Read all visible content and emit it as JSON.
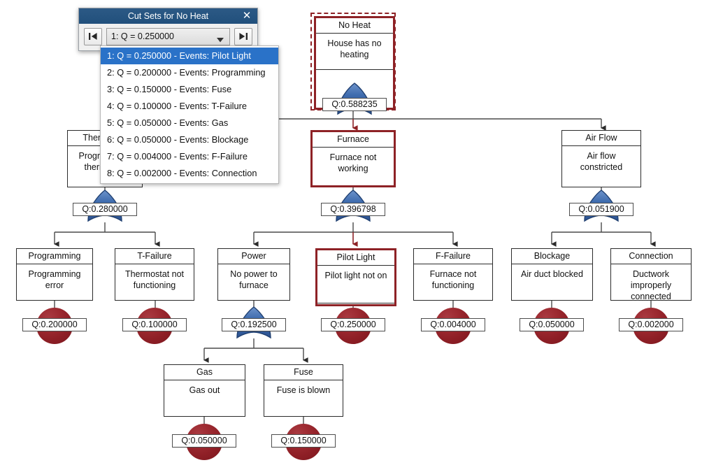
{
  "dialog": {
    "title": "Cut Sets for No Heat",
    "close_label": "✕",
    "prev_button_label": "first",
    "next_button_label": "last",
    "combo_value": "1: Q = 0.250000",
    "combo_caret": "▼",
    "options": [
      "1: Q = 0.250000 - Events: Pilot Light",
      "2: Q = 0.200000 - Events: Programming",
      "3: Q = 0.150000 - Events: Fuse",
      "4: Q = 0.100000 - Events: T-Failure",
      "5: Q = 0.050000 - Events: Gas",
      "6: Q = 0.050000 - Events: Blockage",
      "7: Q = 0.004000 - Events: F-Failure",
      "8: Q = 0.002000 - Events: Connection"
    ],
    "selected_index": 0
  },
  "colors": {
    "highlight": "#8e2226",
    "gate_fill": "#3a66a8",
    "event_fill": "#8e1f26",
    "title_bar": "#21507c",
    "select_blue": "#2a72c8"
  },
  "tree": {
    "nodes": [
      {
        "id": "no-heat",
        "title": "No Heat",
        "desc": "House has no heating",
        "q": "Q:0.588235",
        "symbol": "or-gate",
        "highlight": true,
        "selected": true
      },
      {
        "id": "thermostat",
        "title": "Thermostat",
        "desc": "Programming thermostat",
        "q": "Q:0.280000",
        "symbol": "or-gate",
        "highlight": false,
        "selected": false,
        "occluded": true
      },
      {
        "id": "furnace",
        "title": "Furnace",
        "desc": "Furnace not working",
        "q": "Q:0.396798",
        "symbol": "or-gate",
        "highlight": true,
        "selected": false
      },
      {
        "id": "air-flow",
        "title": "Air Flow",
        "desc": "Air flow constricted",
        "q": "Q:0.051900",
        "symbol": "or-gate",
        "highlight": false,
        "selected": false
      },
      {
        "id": "programming",
        "title": "Programming",
        "desc": "Programming error",
        "q": "Q:0.200000",
        "symbol": "basic-event",
        "highlight": false,
        "selected": false
      },
      {
        "id": "t-failure",
        "title": "T-Failure",
        "desc": "Thermostat not functioning",
        "q": "Q:0.100000",
        "symbol": "basic-event",
        "highlight": false,
        "selected": false
      },
      {
        "id": "power",
        "title": "Power",
        "desc": "No power to furnace",
        "q": "Q:0.192500",
        "symbol": "or-gate",
        "highlight": false,
        "selected": false
      },
      {
        "id": "pilot-light",
        "title": "Pilot Light",
        "desc": "Pilot light not on",
        "q": "Q:0.250000",
        "symbol": "basic-event",
        "highlight": true,
        "selected": false
      },
      {
        "id": "f-failure",
        "title": "F-Failure",
        "desc": "Furnace not functioning",
        "q": "Q:0.004000",
        "symbol": "basic-event",
        "highlight": false,
        "selected": false
      },
      {
        "id": "blockage",
        "title": "Blockage",
        "desc": "Air duct blocked",
        "q": "Q:0.050000",
        "symbol": "basic-event",
        "highlight": false,
        "selected": false
      },
      {
        "id": "connection",
        "title": "Connection",
        "desc": "Ductwork improperly connected",
        "q": "Q:0.002000",
        "symbol": "basic-event",
        "highlight": false,
        "selected": false
      },
      {
        "id": "gas",
        "title": "Gas",
        "desc": "Gas out",
        "q": "Q:0.050000",
        "symbol": "basic-event",
        "highlight": false,
        "selected": false
      },
      {
        "id": "fuse",
        "title": "Fuse",
        "desc": "Fuse is blown",
        "q": "Q:0.150000",
        "symbol": "basic-event",
        "highlight": false,
        "selected": false
      }
    ],
    "edges": [
      {
        "from": "no-heat",
        "to": "thermostat"
      },
      {
        "from": "no-heat",
        "to": "furnace"
      },
      {
        "from": "no-heat",
        "to": "air-flow"
      },
      {
        "from": "thermostat",
        "to": "programming"
      },
      {
        "from": "thermostat",
        "to": "t-failure"
      },
      {
        "from": "furnace",
        "to": "power"
      },
      {
        "from": "furnace",
        "to": "pilot-light"
      },
      {
        "from": "furnace",
        "to": "f-failure"
      },
      {
        "from": "air-flow",
        "to": "blockage"
      },
      {
        "from": "air-flow",
        "to": "connection"
      },
      {
        "from": "power",
        "to": "gas"
      },
      {
        "from": "power",
        "to": "fuse"
      }
    ]
  }
}
